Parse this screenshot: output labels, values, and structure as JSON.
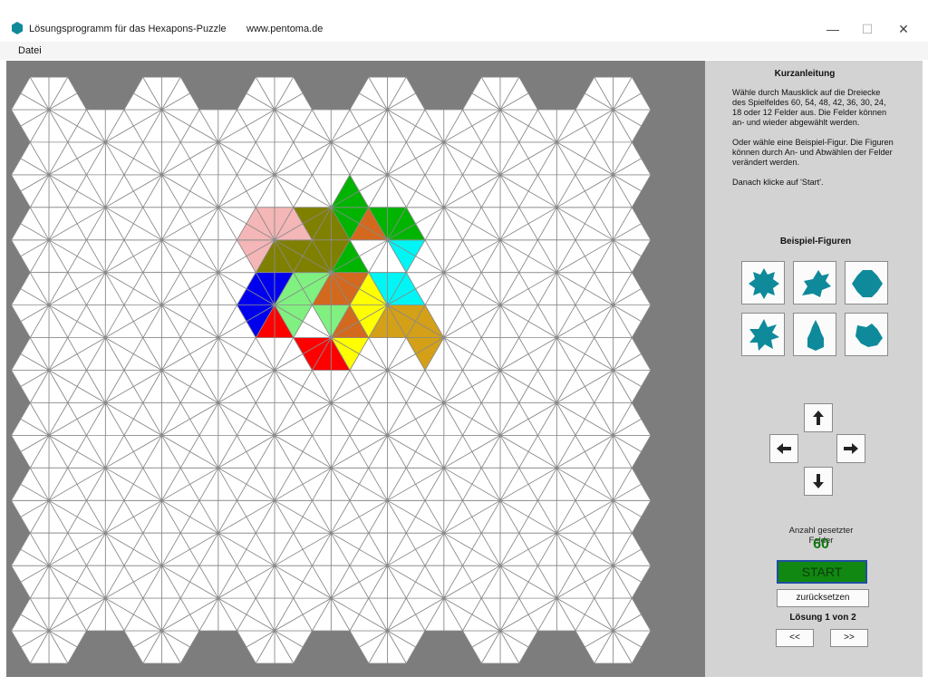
{
  "window": {
    "title": "Lösungsprogramm für das Hexapons-Puzzle",
    "url": "www.pentoma.de",
    "minimize": "—",
    "maximize": "☐",
    "close": "✕"
  },
  "menu": {
    "file": "Datei"
  },
  "instructions": {
    "heading": "Kurzanleitung",
    "lines": [
      "Wähle durch Mausklick auf die Dreiecke",
      "des Spielfeldes 60, 54, 48, 42, 36, 30, 24,",
      "18 oder 12 Felder aus. Die Felder können",
      "an- und wieder abgewählt werden.",
      "",
      "Oder wähle eine Beispiel-Figur. Die Figuren",
      "können  durch An- und Abwählen der Felder",
      "verändert werden.",
      "",
      "Danach klicke auf 'Start'."
    ]
  },
  "examples": {
    "heading": "Beispiel-Figuren",
    "icons": [
      "example-figure-1",
      "example-figure-2",
      "example-figure-3",
      "example-figure-4",
      "example-figure-5",
      "example-figure-6"
    ]
  },
  "arrows": [
    "arrow-up-icon",
    "arrow-left-icon",
    "arrow-right-icon",
    "arrow-down-icon"
  ],
  "status": {
    "count_label": "Anzahl gesetzter Felder",
    "count_value": "60",
    "start_label": "START",
    "reset_label": "zurücksetzen",
    "solution_word": "Lösung",
    "solution_current": "1",
    "solution_of": "von",
    "solution_total": "2",
    "prev_label": "<<",
    "next_label": ">>"
  },
  "colors": {
    "accent_teal": "#0f8a9a",
    "start_green": "#118811",
    "count_green": "#117711",
    "piece_pink": "#f4b6b6",
    "piece_olive": "#7f7f00",
    "piece_green": "#00b400",
    "piece_orange": "#d2691e",
    "piece_cyan": "#00f5f5",
    "piece_lightgreen": "#80f080",
    "piece_blue": "#0000ee",
    "piece_yellow": "#ffff00",
    "piece_gold": "#d4a017",
    "piece_red": "#ff0000"
  }
}
